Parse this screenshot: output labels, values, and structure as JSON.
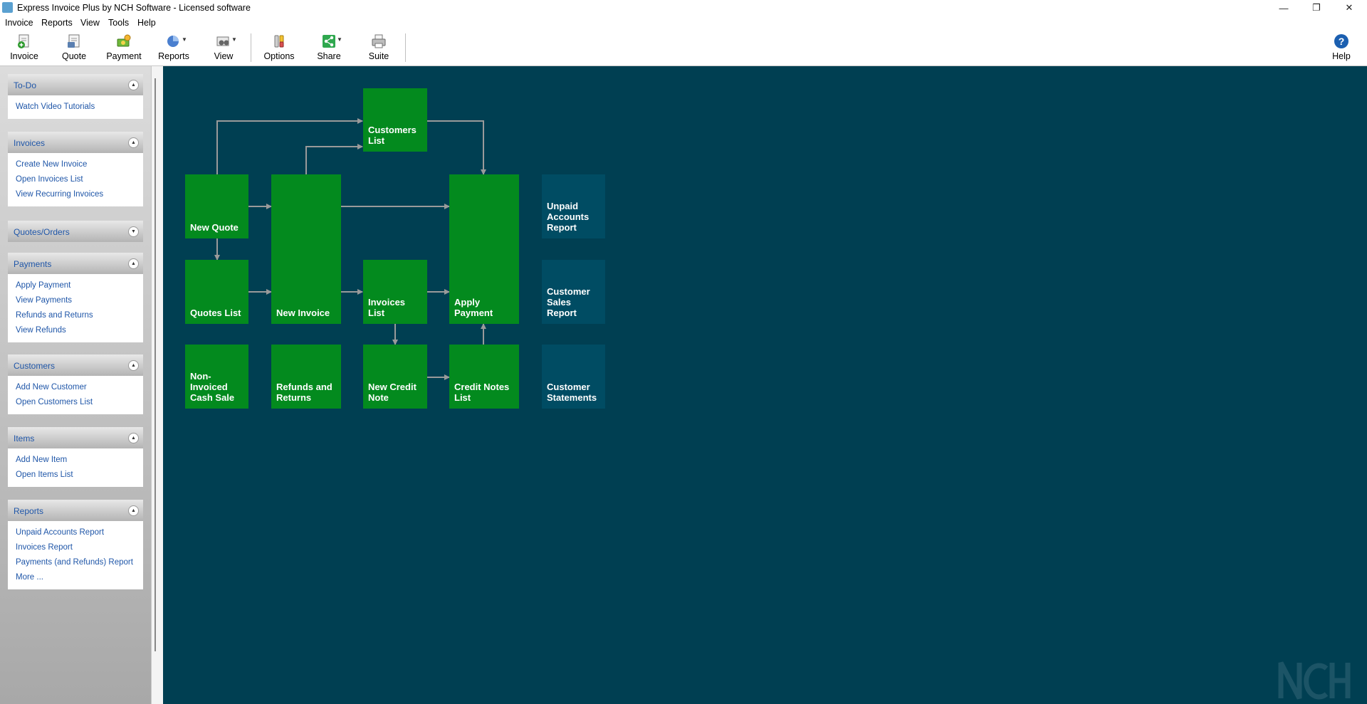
{
  "window": {
    "title": "Express Invoice Plus by NCH Software - Licensed software",
    "minimize_glyph": "—",
    "restore_glyph": "❐",
    "close_glyph": "✕"
  },
  "menu": [
    "Invoice",
    "Reports",
    "View",
    "Tools",
    "Help"
  ],
  "toolbar": {
    "invoice": "Invoice",
    "quote": "Quote",
    "payment": "Payment",
    "reports": "Reports",
    "view": "View",
    "options": "Options",
    "share": "Share",
    "suite": "Suite",
    "help": "Help",
    "dropdown_glyph": "▼"
  },
  "sidebar": {
    "panels": [
      {
        "title": "To-Do",
        "links": [
          "Watch Video Tutorials"
        ]
      },
      {
        "title": "Invoices",
        "links": [
          "Create New Invoice",
          "Open Invoices List",
          "View Recurring Invoices"
        ]
      },
      {
        "title": "Quotes/Orders",
        "links": []
      },
      {
        "title": "Payments",
        "links": [
          "Apply Payment",
          "View Payments",
          "Refunds and Returns",
          "View Refunds"
        ]
      },
      {
        "title": "Customers",
        "links": [
          "Add New Customer",
          "Open Customers List"
        ]
      },
      {
        "title": "Items",
        "links": [
          "Add New Item",
          "Open Items List"
        ]
      },
      {
        "title": "Reports",
        "links": [
          "Unpaid Accounts Report",
          "Invoices Report",
          "Payments (and Refunds) Report",
          "More ..."
        ]
      }
    ],
    "collapse_glyph": "▲",
    "expand_glyph": "▼"
  },
  "flow": {
    "customers_list": [
      "Customers",
      "List"
    ],
    "new_quote": [
      "New Quote"
    ],
    "new_invoice": [
      "New Invoice"
    ],
    "apply_payment": [
      "Apply",
      "Payment"
    ],
    "unpaid_accounts_report": [
      "Unpaid",
      "Accounts",
      "Report"
    ],
    "quotes_list": [
      "Quotes List"
    ],
    "invoices_list": [
      "Invoices",
      "List"
    ],
    "customer_sales_report": [
      "Customer",
      "Sales",
      "Report"
    ],
    "non_invoiced_cash_sale": [
      "Non-",
      "Invoiced",
      "Cash Sale"
    ],
    "refunds_and_returns": [
      "Refunds and",
      "Returns"
    ],
    "new_credit_note": [
      "New Credit",
      "Note"
    ],
    "credit_notes_list": [
      "Credit Notes",
      "List"
    ],
    "customer_statements": [
      "Customer",
      "Statements"
    ]
  },
  "colors": {
    "main_background": "#003f52",
    "tile_green": "#038a1e",
    "tile_report": "#004c63",
    "link_blue": "#1f56a8"
  }
}
